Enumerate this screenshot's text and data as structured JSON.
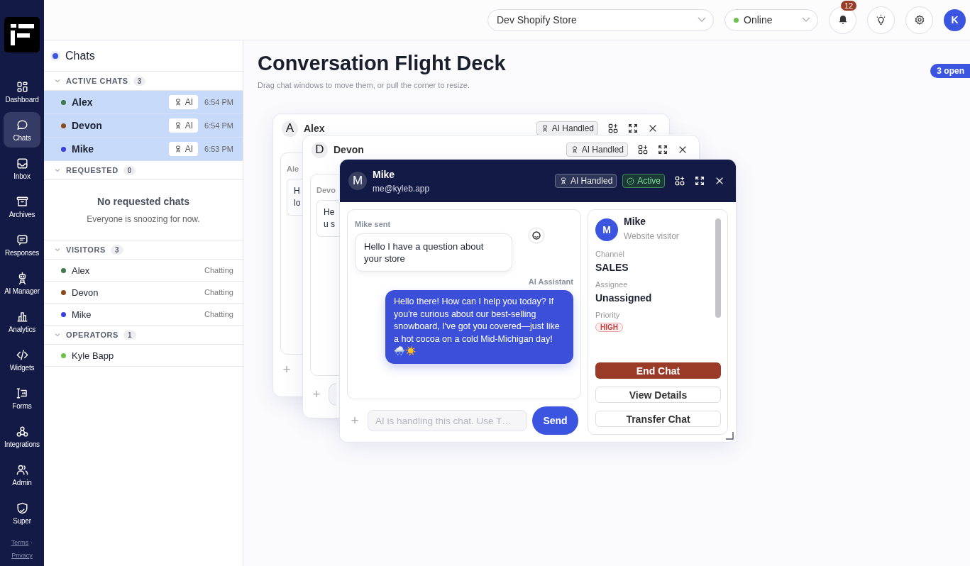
{
  "nav": {
    "items": [
      {
        "label": "Dashboard",
        "selected": false
      },
      {
        "label": "Chats",
        "selected": true
      },
      {
        "label": "Inbox",
        "selected": false
      },
      {
        "label": "Archives",
        "selected": false
      },
      {
        "label": "Responses",
        "selected": false
      },
      {
        "label": "AI Manager",
        "selected": false
      },
      {
        "label": "Analytics",
        "selected": false
      },
      {
        "label": "Widgets",
        "selected": false
      },
      {
        "label": "Forms",
        "selected": false
      },
      {
        "label": "Integrations",
        "selected": false
      },
      {
        "label": "Admin",
        "selected": false
      },
      {
        "label": "Super",
        "selected": false
      }
    ],
    "footer_links": [
      "Terms",
      "Privacy"
    ],
    "footer_separator": "·"
  },
  "topbar": {
    "store_select": {
      "value": "Dev Shopify Store"
    },
    "status_select": {
      "value": "Online",
      "color": "#6cc04a"
    },
    "notifications": {
      "count": "12"
    },
    "avatar": {
      "initial": "K"
    }
  },
  "chats_panel": {
    "title": "Chats",
    "sections": [
      {
        "title": "ACTIVE CHATS",
        "count": "3",
        "expanded": true,
        "kind": "chats",
        "items": [
          {
            "name": "Alex",
            "color": "#3f7a4f",
            "tag": "AI",
            "time": "6:54 PM",
            "selected": true
          },
          {
            "name": "Devon",
            "color": "#8a4a1f",
            "tag": "AI",
            "time": "6:54 PM",
            "selected": true
          },
          {
            "name": "Mike",
            "color": "#3b3fe0",
            "tag": "AI",
            "time": "6:53 PM",
            "selected": true
          }
        ]
      },
      {
        "title": "REQUESTED",
        "count": "0",
        "expanded": true,
        "kind": "empty",
        "empty_title": "No requested chats",
        "empty_text": "Everyone is snoozing for now."
      },
      {
        "title": "VISITORS",
        "count": "3",
        "expanded": true,
        "kind": "people",
        "items": [
          {
            "name": "Alex",
            "color": "#3f7a4f",
            "status": "Chatting"
          },
          {
            "name": "Devon",
            "color": "#8a4a1f",
            "status": "Chatting"
          },
          {
            "name": "Mike",
            "color": "#3b3fe0",
            "status": "Chatting"
          }
        ]
      },
      {
        "title": "OPERATORS",
        "count": "1",
        "expanded": true,
        "kind": "people",
        "items": [
          {
            "name": "Kyle Bapp",
            "color": "#6cc04a"
          }
        ]
      }
    ]
  },
  "deck": {
    "title": "Conversation Flight Deck",
    "subtitle": "Drag chat windows to move them, or pull the corner to resize.",
    "open_badge": "3 open",
    "windows": [
      {
        "initial": "A",
        "name": "Alex",
        "focused": false,
        "badges": [
          "AI Handled"
        ],
        "preview": {
          "sender": "Ale",
          "lines": [
            "H",
            "lo"
          ],
          "add_label": "+",
          "input": false
        }
      },
      {
        "initial": "D",
        "name": "Devon",
        "focused": false,
        "badges": [
          "AI Handled"
        ],
        "preview": {
          "sender": "Devo",
          "lines": [
            "He",
            "u s"
          ],
          "add_label": "+",
          "input": true
        }
      },
      {
        "initial": "M",
        "name": "Mike",
        "email": "me@kyleb.app",
        "focused": true,
        "badges": [
          "AI Handled"
        ],
        "status": "Active",
        "messages": [
          {
            "kind": "visitor",
            "sender": "Mike sent",
            "text": "Hello I have a question about your store"
          },
          {
            "kind": "ai",
            "sender": "AI Assistant",
            "text": "Hello there! How can I help you today? If you're curious about our best-selling snowboard, I've got you covered—just like a hot cocoa on a cold Mid-Michigan day! 🌨️☀️"
          }
        ],
        "add_label": "+",
        "input_placeholder": "AI is handling this chat. Use T…",
        "send_label": "Send",
        "visitor": {
          "initial": "M",
          "name": "Mike",
          "subtitle": "Website visitor",
          "fields": [
            {
              "label": "Channel",
              "value": "SALES",
              "kind": "text"
            },
            {
              "label": "Assignee",
              "value": "Unassigned",
              "kind": "text"
            },
            {
              "label": "Priority",
              "value": "HIGH",
              "kind": "tag"
            }
          ]
        },
        "actions": [
          {
            "label": "End Chat",
            "kind": "danger"
          },
          {
            "label": "View Details",
            "kind": "outline"
          },
          {
            "label": "Transfer Chat",
            "kind": "outline"
          }
        ]
      }
    ]
  }
}
